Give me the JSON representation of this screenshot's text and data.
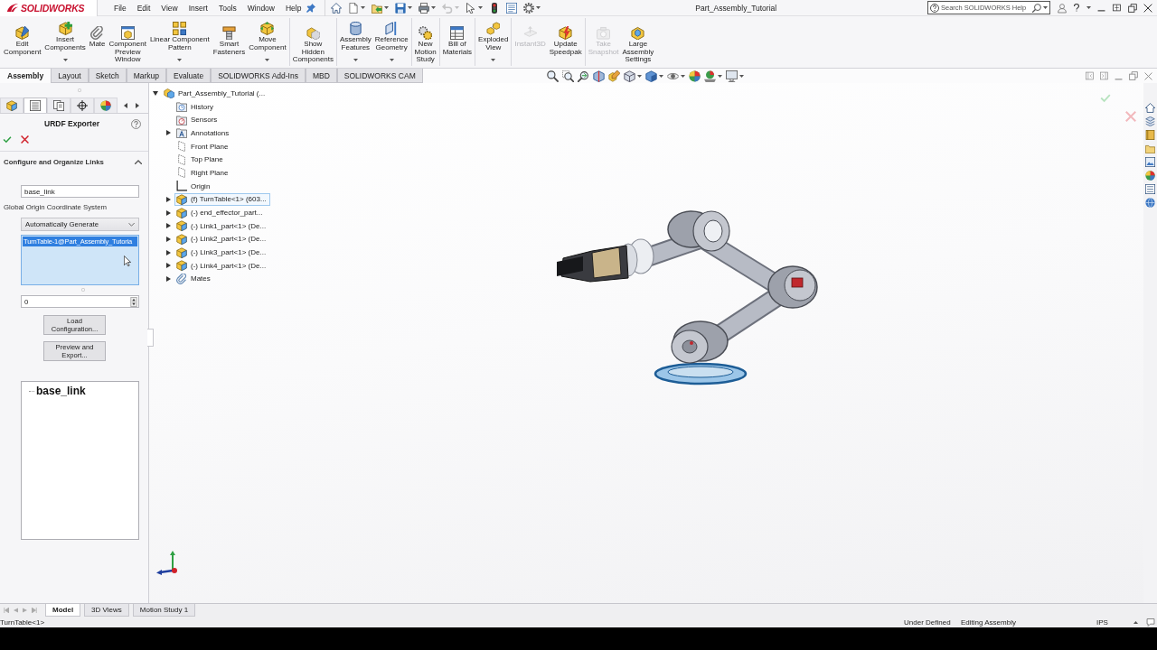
{
  "title_bar": {
    "logo_text": "SOLIDWORKS",
    "menu": [
      "File",
      "Edit",
      "View",
      "Insert",
      "Tools",
      "Window",
      "Help"
    ],
    "quick_access": [
      {
        "kind": "home",
        "dropdown": false,
        "disabled": false
      },
      {
        "kind": "new",
        "dropdown": true,
        "disabled": false
      },
      {
        "kind": "open",
        "dropdown": true,
        "disabled": false
      },
      {
        "kind": "save",
        "dropdown": true,
        "disabled": false
      },
      {
        "kind": "print",
        "dropdown": true,
        "disabled": false
      },
      {
        "kind": "undo",
        "dropdown": true,
        "disabled": true
      },
      {
        "kind": "select",
        "dropdown": true,
        "disabled": false
      },
      {
        "kind": "rebuild",
        "dropdown": false,
        "disabled": false
      },
      {
        "kind": "file-properties",
        "dropdown": false,
        "disabled": false
      },
      {
        "kind": "options",
        "dropdown": true,
        "disabled": false
      }
    ],
    "title": "Part_Assembly_Tutorial",
    "search": {
      "placeholder": "Search SOLIDWORKS Help"
    }
  },
  "ribbon": {
    "groups": [
      {
        "buttons": [
          {
            "kind": "edit-component",
            "label": "Edit\nComponent",
            "dropdown": false,
            "disabled": false
          },
          {
            "kind": "insert-components",
            "label": "Insert\nComponents",
            "dropdown": true,
            "disabled": false
          },
          {
            "kind": "mate",
            "label": "Mate",
            "dropdown": false,
            "disabled": false
          },
          {
            "kind": "component-preview",
            "label": "Component\nPreview\nWindow",
            "dropdown": false,
            "disabled": false
          },
          {
            "kind": "linear-pattern",
            "label": "Linear Component\nPattern",
            "dropdown": true,
            "disabled": false
          },
          {
            "kind": "smart-fasteners",
            "label": "Smart\nFasteners",
            "dropdown": false,
            "disabled": false
          },
          {
            "kind": "move-component",
            "label": "Move\nComponent",
            "dropdown": true,
            "disabled": false
          }
        ]
      },
      {
        "buttons": [
          {
            "kind": "show-hidden",
            "label": "Show\nHidden\nComponents",
            "dropdown": false,
            "disabled": false
          }
        ]
      },
      {
        "buttons": [
          {
            "kind": "assembly-features",
            "label": "Assembly\nFeatures",
            "dropdown": true,
            "disabled": false
          },
          {
            "kind": "reference-geometry",
            "label": "Reference\nGeometry",
            "dropdown": true,
            "disabled": false
          }
        ]
      },
      {
        "buttons": [
          {
            "kind": "motion-study",
            "label": "New\nMotion\nStudy",
            "dropdown": false,
            "disabled": false
          }
        ]
      },
      {
        "buttons": [
          {
            "kind": "bill-of-materials",
            "label": "Bill of\nMaterials",
            "dropdown": false,
            "disabled": false
          }
        ]
      },
      {
        "buttons": [
          {
            "kind": "exploded-view",
            "label": "Exploded\nView",
            "dropdown": true,
            "disabled": false
          }
        ]
      },
      {
        "buttons": [
          {
            "kind": "instant3d",
            "label": "Instant3D",
            "dropdown": false,
            "disabled": true
          },
          {
            "kind": "update-speedpak",
            "label": "Update\nSpeedpak",
            "dropdown": false,
            "disabled": false
          }
        ]
      },
      {
        "buttons": [
          {
            "kind": "take-snapshot",
            "label": "Take\nSnapshot",
            "dropdown": false,
            "disabled": true
          },
          {
            "kind": "large-assembly",
            "label": "Large\nAssembly\nSettings",
            "dropdown": false,
            "disabled": false
          }
        ]
      }
    ]
  },
  "ribbon_tabs": [
    {
      "label": "Assembly",
      "selected": true
    },
    {
      "label": "Layout",
      "selected": false
    },
    {
      "label": "Sketch",
      "selected": false
    },
    {
      "label": "Markup",
      "selected": false
    },
    {
      "label": "Evaluate",
      "selected": false
    },
    {
      "label": "SOLIDWORKS Add-Ins",
      "selected": false
    },
    {
      "label": "MBD",
      "selected": false
    },
    {
      "label": "SOLIDWORKS CAM",
      "selected": false
    }
  ],
  "heads_up_toolbar": [
    {
      "kind": "zoom-fit",
      "dropdown": false
    },
    {
      "kind": "zoom-area",
      "dropdown": false
    },
    {
      "kind": "previous-view",
      "dropdown": false
    },
    {
      "kind": "section-view",
      "dropdown": false
    },
    {
      "kind": "dynamic-annotation",
      "dropdown": false
    },
    {
      "kind": "view-orientation",
      "dropdown": true
    },
    {
      "kind": "display-style",
      "dropdown": true
    },
    {
      "kind": "hide-show",
      "dropdown": true
    },
    {
      "kind": "edit-appearance",
      "dropdown": false
    },
    {
      "kind": "apply-scene",
      "dropdown": true
    },
    {
      "kind": "view-settings",
      "dropdown": true
    }
  ],
  "property_manager": {
    "panel_tabs": [
      {
        "kind": "feature-manager",
        "selected": false
      },
      {
        "kind": "property-manager",
        "selected": true
      },
      {
        "kind": "configuration-manager",
        "selected": false
      },
      {
        "kind": "dimxpert",
        "selected": false
      },
      {
        "kind": "display-manager",
        "selected": false
      }
    ],
    "title": "URDF Exporter",
    "section": {
      "title": "Configure and Organize Links",
      "expanded": true
    },
    "link_name": {
      "value": "base_link"
    },
    "coordinate_system": {
      "label": "Global Origin Coordinate System",
      "value": "Automatically Generate"
    },
    "axis_list": {
      "items": [
        {
          "label": "TurnTable-1@Part_Assembly_Tutoria",
          "selected": true
        }
      ]
    },
    "number_field": {
      "value": "0"
    },
    "buttons": [
      "Load\nConfiguration...",
      "Preview and\nExport..."
    ],
    "link_tree": [
      {
        "label": "base_link"
      }
    ]
  },
  "feature_tree": {
    "root": {
      "label": "Part_Assembly_Tutorial (...",
      "kind": "assembly",
      "expanded": true,
      "selected": false,
      "children": [
        {
          "label": "History",
          "kind": "history",
          "selected": false
        },
        {
          "label": "Sensors",
          "kind": "sensors",
          "selected": false
        },
        {
          "label": "Annotations",
          "kind": "annotations",
          "expanded": false,
          "selected": false
        },
        {
          "label": "Front Plane",
          "kind": "plane",
          "selected": false
        },
        {
          "label": "Top Plane",
          "kind": "plane",
          "selected": false
        },
        {
          "label": "Right Plane",
          "kind": "plane",
          "selected": false
        },
        {
          "label": "Origin",
          "kind": "origin",
          "selected": false
        },
        {
          "label": "(f) TurnTable<1> (603...",
          "kind": "part",
          "expanded": false,
          "selected": true
        },
        {
          "label": "(-) end_effector_part...",
          "kind": "part",
          "expanded": false,
          "selected": false
        },
        {
          "label": "(-) Link1_part<1> (De...",
          "kind": "part",
          "expanded": false,
          "selected": false
        },
        {
          "label": "(-) Link2_part<1> (De...",
          "kind": "part",
          "expanded": false,
          "selected": false
        },
        {
          "label": "(-) Link3_part<1> (De...",
          "kind": "part",
          "expanded": false,
          "selected": false
        },
        {
          "label": "(-) Link4_part<1> (De...",
          "kind": "part",
          "expanded": false,
          "selected": false
        },
        {
          "label": "Mates",
          "kind": "mates",
          "expanded": false,
          "selected": false
        }
      ]
    }
  },
  "bottom_tabs": [
    {
      "label": "Model",
      "selected": true
    },
    {
      "label": "3D Views",
      "selected": false
    },
    {
      "label": "Motion Study 1",
      "selected": false
    }
  ],
  "status_bar": {
    "selection": "TurnTable<1>",
    "status": "Under Defined",
    "mode": "Editing Assembly",
    "units": "IPS"
  }
}
